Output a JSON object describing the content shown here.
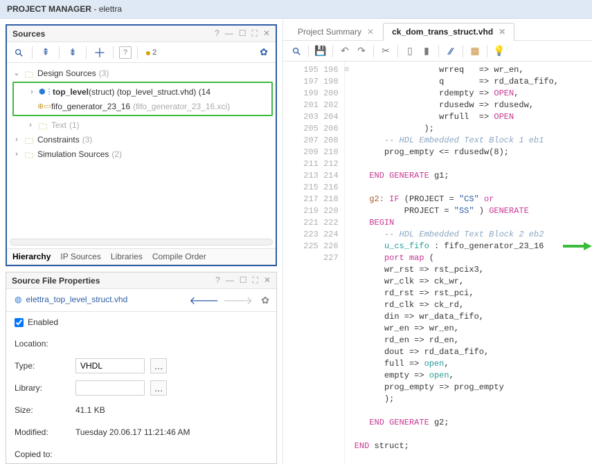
{
  "titlebar": {
    "prefix": "PROJECT MANAGER",
    "sep": " - ",
    "project": "elettra"
  },
  "sources": {
    "title": "Sources",
    "warn_count": "2",
    "tree": {
      "root": "Design Sources",
      "root_count": "(3)",
      "item1_bold": "top_level",
      "item1_mid": "(struct) (top_level_struct.vhd) (14",
      "item2": "fifo_generator_23_16",
      "item2_grey": " (fifo_generator_23_16.xci)",
      "item3": "Text",
      "item3_count": "(1)",
      "constraints": "Constraints",
      "constraints_count": "(3)",
      "sim": "Simulation Sources",
      "sim_count": "(2)"
    },
    "tabs": {
      "t1": "Hierarchy",
      "t2": "IP Sources",
      "t3": "Libraries",
      "t4": "Compile Order"
    }
  },
  "props": {
    "title": "Source File Properties",
    "file": "elettra_top_level_struct.vhd",
    "enabled": "Enabled",
    "loc_label": "Location:",
    "type_label": "Type:",
    "type_value": "VHDL",
    "lib_label": "Library:",
    "lib_value": "",
    "size_label": "Size:",
    "size_value": "41.1 KB",
    "mod_label": "Modified:",
    "mod_value": "Tuesday 20.06.17 11:21:46 AM",
    "copied_label": "Copied to:"
  },
  "editor": {
    "tab1": "Project Summary",
    "tab2": "ck_dom_trans_struct.vhd",
    "lines_start": 195,
    "code": [
      "                 wrreq   => wr_en,",
      "                 q       => rd_data_fifo,",
      "                 rdempty => <PINK>OPEN</PINK>,",
      "                 rdusedw => rdusedw,",
      "                 wrfull  => <PINK>OPEN</PINK>",
      "              );",
      "      <COM>-- HDL Embedded Text Block 1 eb1</COM>",
      "      prog_empty <= rdusedw(8);",
      "",
      "   <PINK>END</PINK> <PINK>GENERATE</PINK> g1;",
      "",
      "   <TAG>g2:</TAG> <PINK>IF</PINK> (PROJECT = <STR>\"CS\"</STR> <PINK>or</PINK>",
      "          PROJECT = <STR>\"SS\"</STR> ) <PINK>GENERATE</PINK>",
      "   <PINK>BEGIN</PINK>",
      "      <COM>-- HDL Embedded Text Block 2 eb2</COM>",
      "      <TEAL>u_cs_fifo</TEAL> : fifo_generator_23_16<ARROW>",
      "      <PINK>port map</PINK> (",
      "      wr_rst => rst_pcix3,",
      "      wr_clk => ck_wr,",
      "      rd_rst => rst_pci,",
      "      rd_clk => ck_rd,",
      "      din => wr_data_fifo,",
      "      wr_en => wr_en,",
      "      rd_en => rd_en,",
      "      dout => rd_data_fifo,",
      "      full => <TEAL>open</TEAL>,",
      "      empty => <TEAL>open</TEAL>,",
      "      prog_empty => prog_empty",
      "      );",
      "",
      "   <PINK>END</PINK> <PINK>GENERATE</PINK> g2;",
      "",
      "<PINK>END</PINK> struct;"
    ]
  }
}
